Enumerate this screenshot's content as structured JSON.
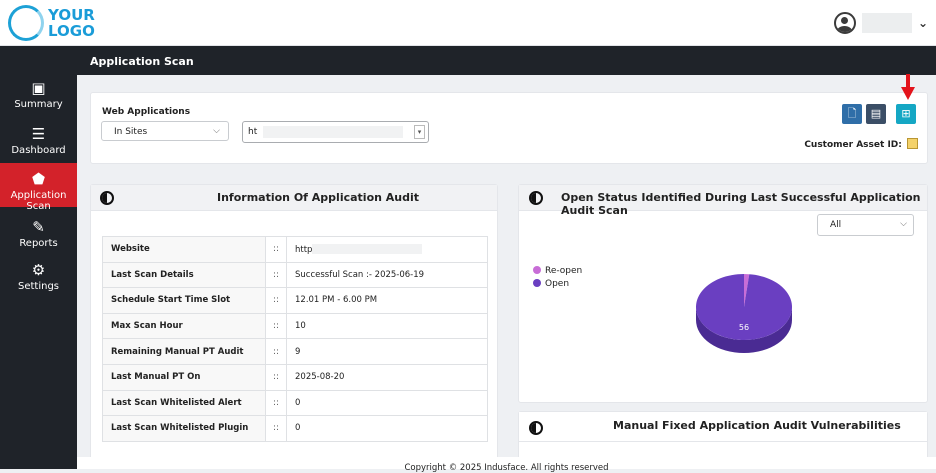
{
  "logo": {
    "line1": "YOUR",
    "line2": "LOGO"
  },
  "header": {
    "user_icon": "user-circle-icon",
    "dropdown_icon": "chevron-down-icon"
  },
  "sidebar": {
    "items": [
      {
        "label": "Summary",
        "icon": "summary-icon",
        "active": false
      },
      {
        "label": "Dashboard",
        "icon": "dashboard-icon",
        "active": false
      },
      {
        "label": "Application Scan",
        "icon": "shield-icon",
        "active": true
      },
      {
        "label": "Reports",
        "icon": "edit-icon",
        "active": false
      },
      {
        "label": "Settings",
        "icon": "gear-icon",
        "active": false
      }
    ]
  },
  "page": {
    "title": "Application Scan"
  },
  "webapps": {
    "label": "Web Applications",
    "type_select": "In Sites",
    "site_select": "ht",
    "customer_asset_label": "Customer Asset ID:",
    "tools": [
      "report-icon",
      "export-icon",
      "scan-icon"
    ],
    "colors": {
      "tool1": "#2f6ea8",
      "tool2": "#3b4e66",
      "tool3": "#15a7c4"
    }
  },
  "audit": {
    "title": "Information Of Application Audit",
    "separator": "::",
    "rows": [
      {
        "key": "Website",
        "value": "http"
      },
      {
        "key": "Last Scan Details",
        "value": "Successful Scan :- 2025-06-19"
      },
      {
        "key": "Schedule Start Time Slot",
        "value": "12.01 PM - 6.00 PM"
      },
      {
        "key": "Max Scan Hour",
        "value": "10"
      },
      {
        "key": "Remaining Manual PT Audit",
        "value": "9"
      },
      {
        "key": "Last Manual PT On",
        "value": "2025-08-20"
      },
      {
        "key": "Last Scan Whitelisted Alert",
        "value": "0"
      },
      {
        "key": "Last Scan Whitelisted Plugin",
        "value": "0"
      }
    ]
  },
  "open_status": {
    "title": "Open Status Identified During Last Successful Application Audit Scan",
    "filter": "All",
    "legend": [
      {
        "label": "Re-open",
        "color": "#c86dd7"
      },
      {
        "label": "Open",
        "color": "#6a3fc1"
      }
    ],
    "chart_data": {
      "type": "pie",
      "categories": [
        "Re-open",
        "Open"
      ],
      "values": [
        1,
        56
      ],
      "data_labels": [
        "",
        "56"
      ]
    }
  },
  "manual": {
    "title": "Manual Fixed Application Audit Vulnerabilities"
  },
  "footer": {
    "text": "Copyright © 2025 Indusface. All rights reserved"
  }
}
